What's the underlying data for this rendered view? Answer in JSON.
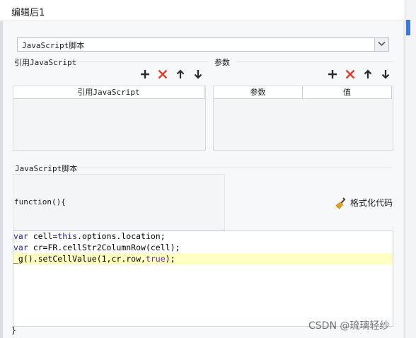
{
  "window": {
    "title": "编辑后1"
  },
  "script_type_select": {
    "value": "JavaScript脚本"
  },
  "imports_section": {
    "label": "引用JavaScript",
    "columns": [
      "引用JavaScript"
    ]
  },
  "params_section": {
    "label": "参数",
    "columns": [
      "参数",
      "值"
    ]
  },
  "toolbar_icons": [
    "add-icon",
    "delete-icon",
    "move-up-icon",
    "move-down-icon"
  ],
  "script_section": {
    "label": "JavaScript脚本",
    "function_header": "function(){",
    "format_button": "格式化代码",
    "closing": "}",
    "code_lines": [
      "var cell=this.options.location;",
      "var cr=FR.cellStr2ColumnRow(cell);",
      "_g().setCellValue(1,cr.row,true);"
    ]
  },
  "watermark": "CSDN @琉璃轻纱",
  "colors": {
    "delete_icon": "#e03c31",
    "highlight_line": "#ffffc2",
    "keyword": "#1a1aa6"
  }
}
